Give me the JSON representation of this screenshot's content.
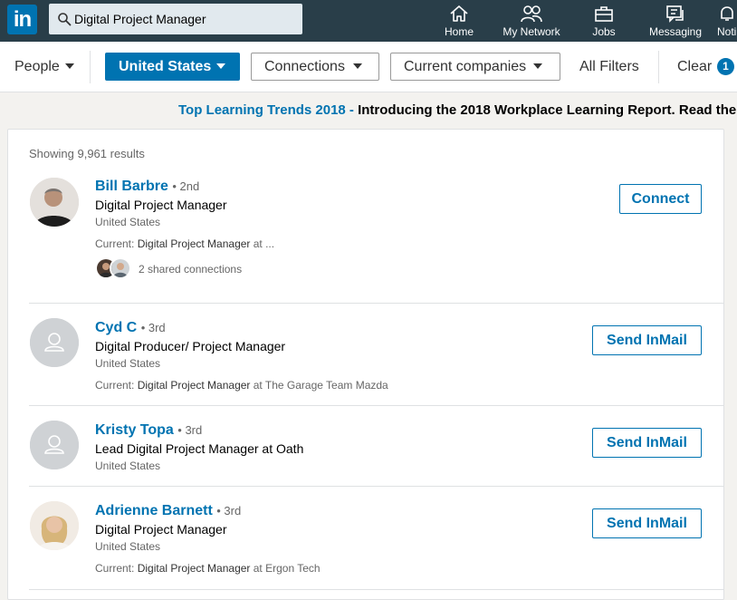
{
  "nav": {
    "logo_text": "in",
    "search_value": "Digital Project Manager",
    "items": [
      {
        "label": "Home",
        "icon": "home-icon"
      },
      {
        "label": "My Network",
        "icon": "network-icon"
      },
      {
        "label": "Jobs",
        "icon": "briefcase-icon"
      },
      {
        "label": "Messaging",
        "icon": "messaging-icon"
      },
      {
        "label": "Noti",
        "icon": "bell-icon"
      }
    ]
  },
  "filters": {
    "people": "People",
    "location": "United States",
    "connections": "Connections",
    "companies": "Current companies",
    "all": "All Filters",
    "clear": "Clear",
    "count": "1"
  },
  "promo": {
    "link": "Top Learning Trends 2018 -",
    "text": " Introducing the 2018 Workplace Learning Report. Read the"
  },
  "results": {
    "showing": "Showing 9,961 results",
    "items": [
      {
        "name": "Bill Barbre",
        "degree": "• 2nd",
        "title": "Digital Project Manager",
        "location": "United States",
        "current_prefix": "Current: ",
        "current_role": "Digital Project Manager",
        "current_suffix": " at ...",
        "shared": "2 shared connections",
        "action": "Connect"
      },
      {
        "name": "Cyd C",
        "degree": "• 3rd",
        "title": "Digital Producer/ Project Manager",
        "location": "United States",
        "current_prefix": "Current: ",
        "current_role": "Digital Project Manager",
        "current_suffix": " at The Garage Team Mazda",
        "action": "Send InMail"
      },
      {
        "name": "Kristy Topa",
        "degree": "• 3rd",
        "title": "Lead Digital Project Manager at Oath",
        "location": "United States",
        "action": "Send InMail"
      },
      {
        "name": "Adrienne Barnett",
        "degree": "• 3rd",
        "title": "Digital Project Manager",
        "location": "United States",
        "current_prefix": "Current: ",
        "current_role": "Digital Project Manager",
        "current_suffix": " at Ergon Tech",
        "action": "Send InMail"
      }
    ]
  }
}
